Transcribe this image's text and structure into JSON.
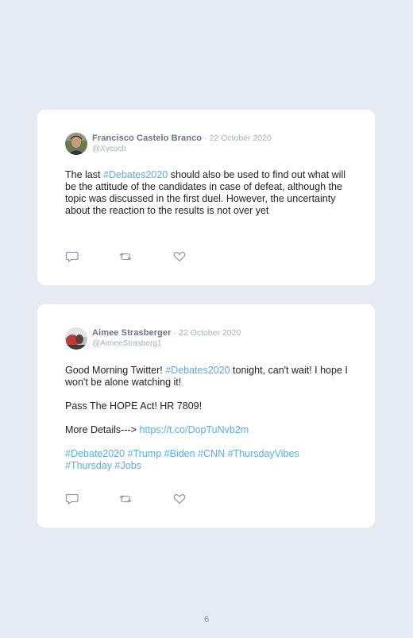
{
  "page_number": "6",
  "tweets": [
    {
      "name": "Francisco Castelo Branco",
      "separator": "·",
      "date": "22 October 2020",
      "handle": "@Xycocb",
      "text": {
        "t1": "The last ",
        "tag1": "#Debates2020",
        "t2": " should also be used to find out what will be the attitude of the candidates in case of defeat, although the topic was discussed in the first duel. However, the uncertainty about the reaction to the results is not over yet"
      }
    },
    {
      "name": "Aimee Strasberger",
      "separator": "·",
      "date": "22 October 2020",
      "handle": "@AimeeStrasberg1",
      "text": {
        "p1_a": "Good Morning Twitter! ",
        "p1_tag": "#Debates2020",
        "p1_b": " tonight, can't wait! I hope I won't be alone watching it!",
        "p2": "Pass The HOPE Act! HR 7809!",
        "p3_a": "More Details--->",
        "p3_link": "https://t.co/DopTuNvb2m",
        "hashtags": [
          "#Debate2020",
          "#Trump",
          "#Biden",
          "#CNN",
          "#ThursdayVibes",
          "#Thursday",
          "#Jobs"
        ]
      }
    }
  ],
  "icons": [
    "reply-icon",
    "retweet-icon",
    "like-icon"
  ],
  "colors": {
    "background": "#e6eaf2",
    "card": "#ffffff",
    "name": "#6b7585",
    "muted": "#a8b0bc",
    "link": "#5aaee6"
  }
}
